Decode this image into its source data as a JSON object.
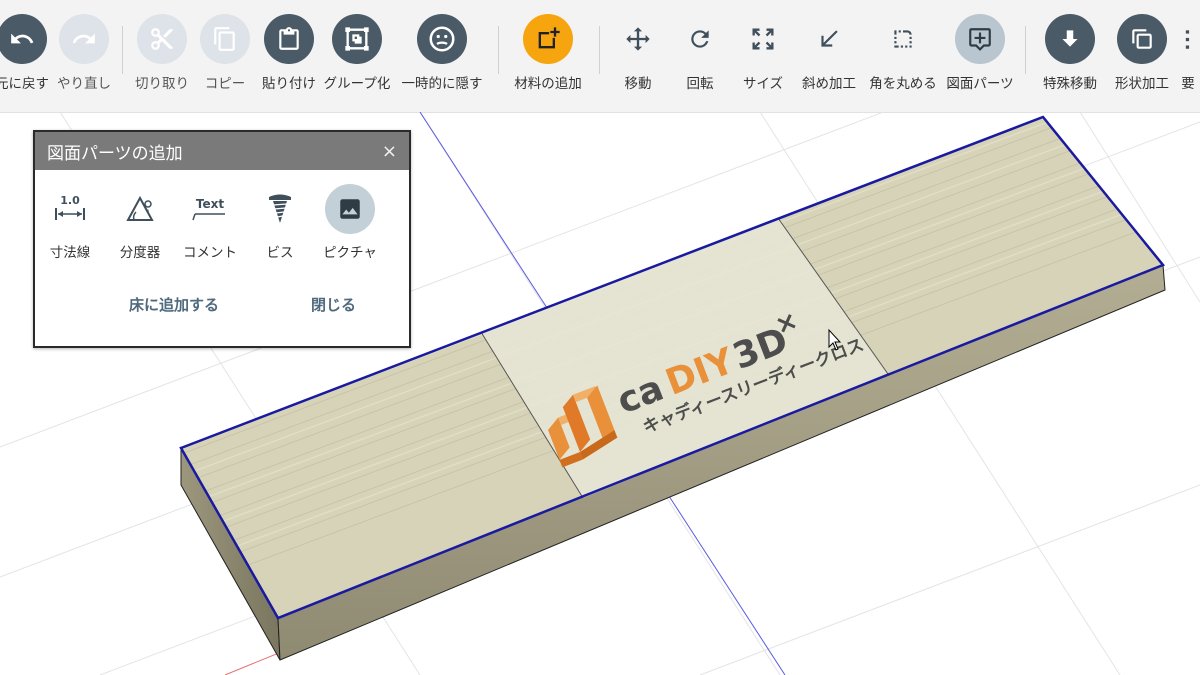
{
  "toolbar": {
    "undo": {
      "label": "元に戻す",
      "icon": "undo-icon"
    },
    "redo": {
      "label": "やり直し",
      "icon": "redo-icon"
    },
    "cut": {
      "label": "切り取り",
      "icon": "scissors-icon"
    },
    "copy": {
      "label": "コピー",
      "icon": "copy-icon"
    },
    "paste": {
      "label": "貼り付け",
      "icon": "clipboard-icon"
    },
    "group": {
      "label": "グループ化",
      "icon": "group-icon"
    },
    "hide": {
      "label": "一時的に隠す",
      "icon": "hide-face-icon"
    },
    "add_material": {
      "label": "材料の追加",
      "icon": "add-material-icon"
    },
    "move": {
      "label": "移動",
      "icon": "move-arrows-icon"
    },
    "rotate": {
      "label": "回転",
      "icon": "rotate-icon"
    },
    "size": {
      "label": "サイズ",
      "icon": "resize-icon"
    },
    "bevel": {
      "label": "斜め加工",
      "icon": "diagonal-arrow-icon"
    },
    "round": {
      "label": "角を丸める",
      "icon": "round-corner-icon"
    },
    "drawing_parts": {
      "label": "図面パーツ",
      "icon": "add-comment-icon"
    },
    "special_move": {
      "label": "特殊移動",
      "icon": "arrow-down-circle-icon"
    },
    "shape_process": {
      "label": "形状加工",
      "icon": "shape-icon"
    },
    "more": {
      "label": "要",
      "icon": "more-icon"
    }
  },
  "dialog": {
    "title": "図面パーツの追加",
    "close": "×",
    "items": [
      {
        "label": "寸法線",
        "icon": "dimension-line-icon",
        "icon_text": "1.0"
      },
      {
        "label": "分度器",
        "icon": "protractor-icon"
      },
      {
        "label": "コメント",
        "icon": "comment-text-icon",
        "icon_text": "Text"
      },
      {
        "label": "ビス",
        "icon": "screw-icon"
      },
      {
        "label": "ピクチャ",
        "icon": "picture-icon",
        "selected": true
      }
    ],
    "add_to_floor": "床に追加する",
    "close_button": "閉じる"
  },
  "model": {
    "logo_main_a": "ca",
    "logo_main_b": "DIY",
    "logo_main_c": "3D",
    "logo_mark": "×",
    "logo_sub": "キャディースリーディークロス"
  },
  "colors": {
    "toolbar_bg": "#f3f3f3",
    "button_dark": "#4a5a66",
    "accent_orange": "#f6a50f",
    "edge_blue": "#1a1aa0",
    "logo_orange": "#e8913a",
    "logo_gray": "#555555"
  }
}
